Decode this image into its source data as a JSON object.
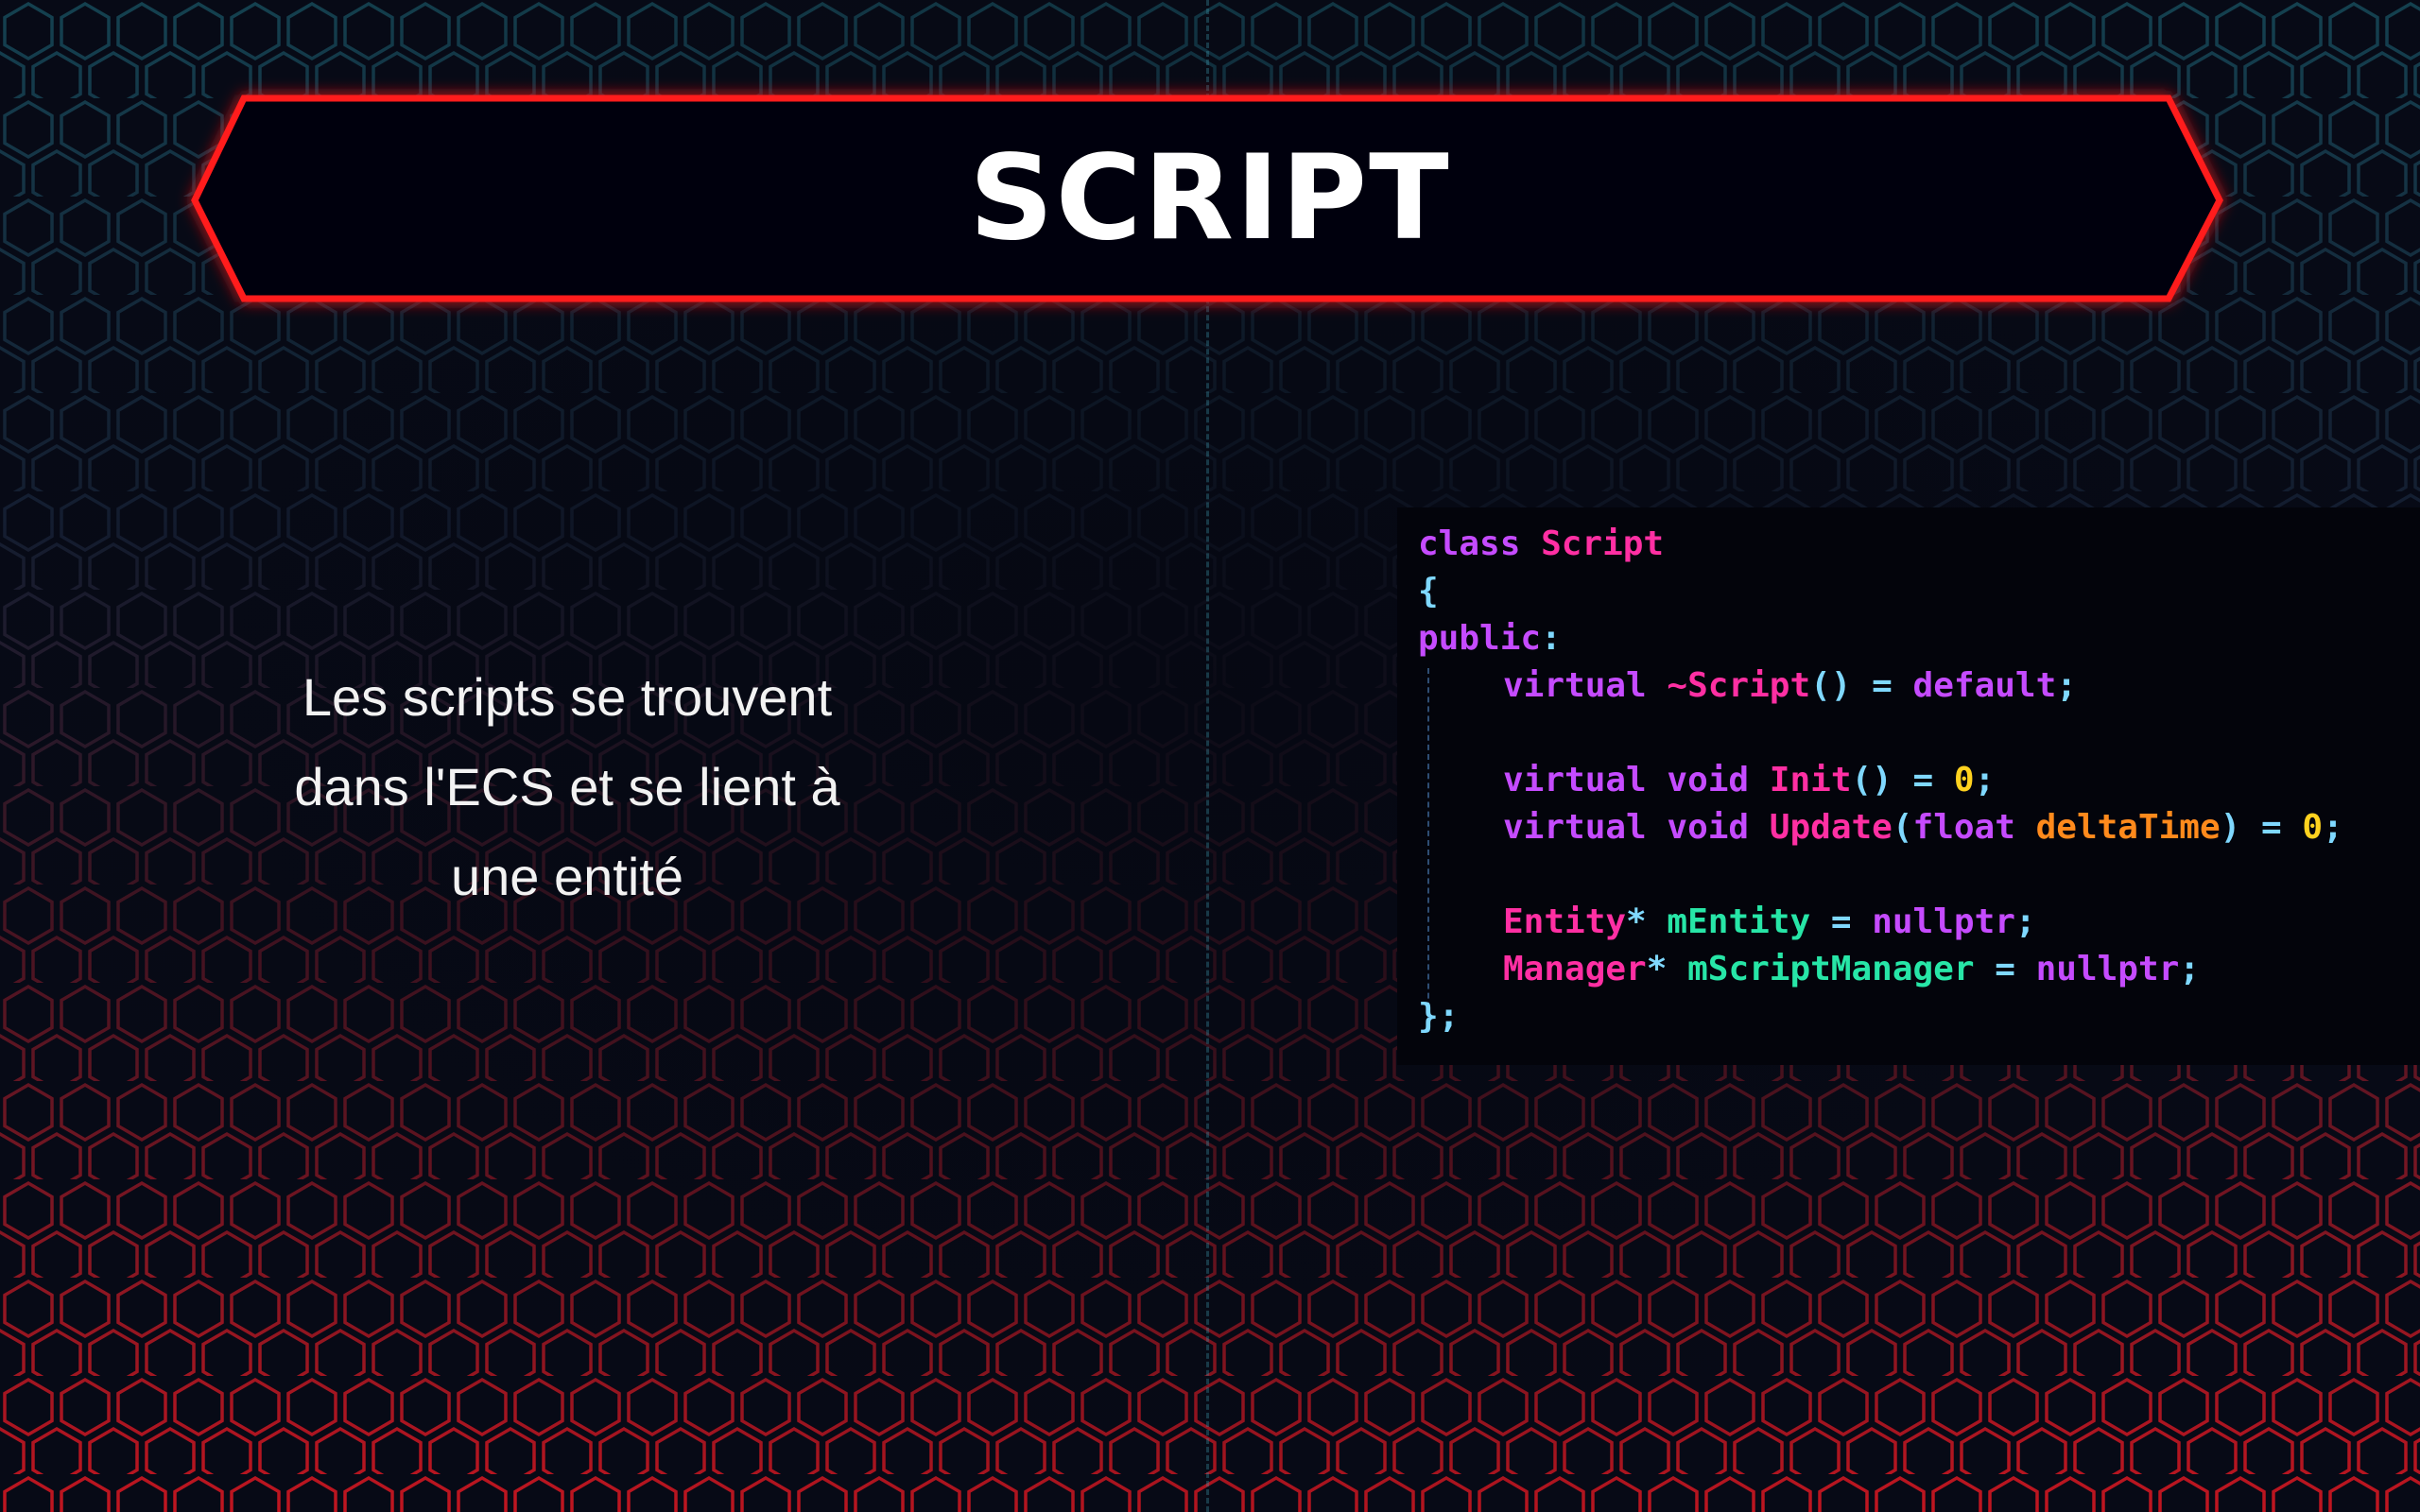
{
  "title": "SCRIPT",
  "description": {
    "line1": "Les scripts se trouvent",
    "line2": "dans l'ECS et se lient à",
    "line3": "une entité"
  },
  "code": {
    "t_class": "class",
    "t_Script": "Script",
    "t_open": "{",
    "t_public": "public",
    "t_colon": ":",
    "t_virtual": "virtual",
    "t_dtor": "~Script",
    "t_parens": "()",
    "t_eq": "=",
    "t_default": "default",
    "t_semi": ";",
    "t_void": "void",
    "t_init": "Init",
    "t_zero": "0",
    "t_update": "Update",
    "t_lparen": "(",
    "t_float": "float",
    "t_deltaTime": "deltaTime",
    "t_rparen": ")",
    "t_Entity": "Entity",
    "t_star": "*",
    "t_mEntity": "mEntity",
    "t_nullptr": "nullptr",
    "t_Manager": "Manager",
    "t_mScriptManager": "mScriptManager",
    "t_close": "}"
  },
  "colors": {
    "banner_border": "#ff1a1a",
    "keyword": "#c54bff",
    "type": "#ff2fa3",
    "punctuation": "#7fd8ff",
    "number": "#ffd21f",
    "parameter": "#ff8a1c",
    "member": "#27e6a7"
  }
}
